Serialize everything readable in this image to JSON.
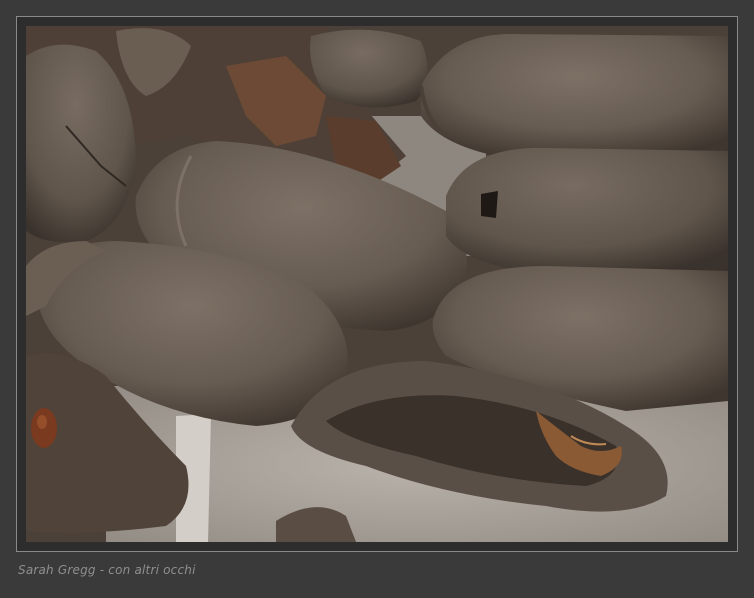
{
  "photo": {
    "subject_icon": "mud-dauber-nest-photo"
  },
  "caption": {
    "text": "Sarah Gregg - con altri occhi"
  },
  "colors": {
    "background": "#3a3a3a",
    "frame_border": "#8a8a8a",
    "caption": "#8f8f8f"
  }
}
